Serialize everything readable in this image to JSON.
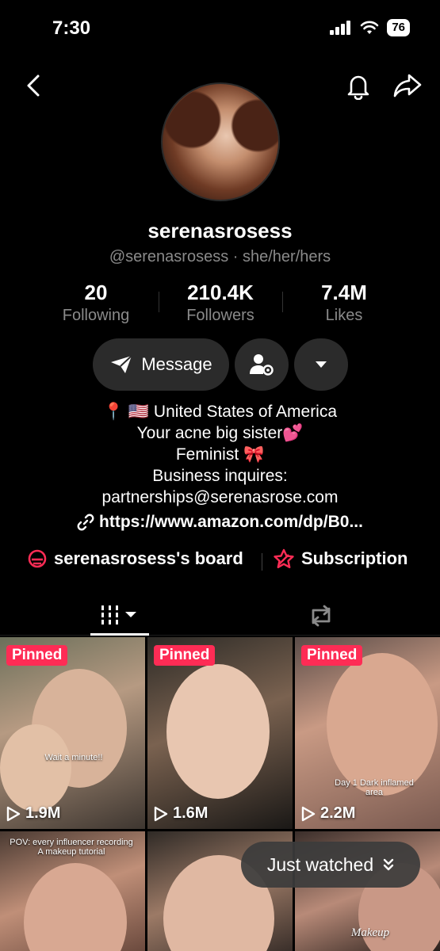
{
  "status": {
    "time": "7:30",
    "battery": "76"
  },
  "profile": {
    "display_name": "serenasrosess",
    "handle_line": "@serenasrosess · she/her/hers"
  },
  "stats": {
    "following": {
      "value": "20",
      "label": "Following"
    },
    "followers": {
      "value": "210.4K",
      "label": "Followers"
    },
    "likes": {
      "value": "7.4M",
      "label": "Likes"
    }
  },
  "actions": {
    "message_label": "Message"
  },
  "bio": {
    "lines": [
      "📍 🇺🇸 United States of America",
      "Your acne big sister💕",
      "Feminist 🎀",
      "Business inquires:",
      "partnerships@serenasrose.com"
    ],
    "link": "https://www.amazon.com/dp/B0..."
  },
  "shortcuts": {
    "board": "serenasrosess's board",
    "subscription": "Subscription"
  },
  "accent_color": "#fe2c55",
  "grid": {
    "pinned_label": "Pinned",
    "videos": [
      {
        "views": "1.9M",
        "pinned": true,
        "caption": "Wait a minute!!"
      },
      {
        "views": "1.6M",
        "pinned": true,
        "caption": ""
      },
      {
        "views": "2.2M",
        "pinned": true,
        "caption": "Day 1 Dark inflamed area"
      },
      {
        "views": "",
        "pinned": false,
        "caption": "POV: every influencer recording A makeup tutorial"
      },
      {
        "views": "",
        "pinned": false,
        "caption": ""
      },
      {
        "views": "",
        "pinned": false,
        "caption": "Makeup"
      }
    ]
  },
  "floating": {
    "just_watched": "Just watched"
  }
}
